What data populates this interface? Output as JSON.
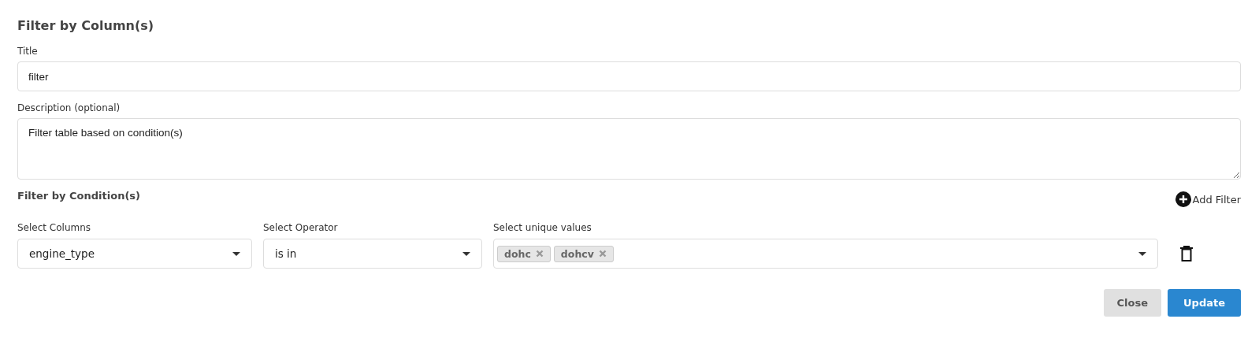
{
  "heading": "Filter by Column(s)",
  "title_field": {
    "label": "Title",
    "value": "filter"
  },
  "description_field": {
    "label": "Description (optional)",
    "value": "Filter table based on condition(s)"
  },
  "conditions": {
    "heading": "Filter by Condition(s)",
    "add_button": "Add Filter",
    "filters": [
      {
        "column": {
          "label": "Select Columns",
          "value": "engine_type"
        },
        "operator": {
          "label": "Select Operator",
          "value": "is in"
        },
        "values": {
          "label": "Select unique values",
          "tags": [
            "dohc",
            "dohcv"
          ]
        }
      }
    ]
  },
  "buttons": [
    {
      "label": "Close",
      "kind": "secondary"
    },
    {
      "label": "Update",
      "kind": "primary"
    }
  ]
}
